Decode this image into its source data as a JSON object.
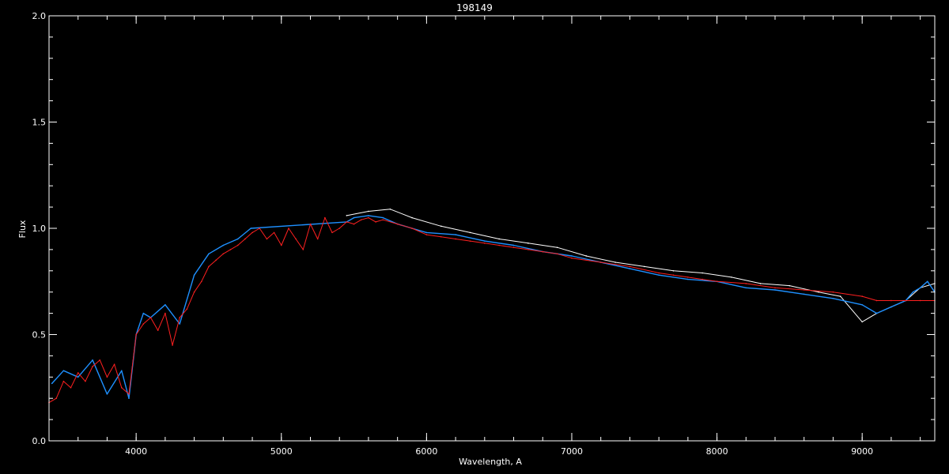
{
  "chart_data": {
    "type": "line",
    "title": "198149",
    "xlabel": "Wavelength, A",
    "ylabel": "Flux",
    "xlim": [
      3400,
      9500
    ],
    "ylim": [
      0.0,
      2.0
    ],
    "x_ticks": [
      {
        "value": 4000,
        "label": "4000"
      },
      {
        "value": 5000,
        "label": "5000"
      },
      {
        "value": 6000,
        "label": "6000"
      },
      {
        "value": 7000,
        "label": "7000"
      },
      {
        "value": 8000,
        "label": "8000"
      },
      {
        "value": 9000,
        "label": "9000"
      }
    ],
    "y_ticks": [
      {
        "value": 0.0,
        "label": "0.0"
      },
      {
        "value": 0.5,
        "label": "0.5"
      },
      {
        "value": 1.0,
        "label": "1.0"
      },
      {
        "value": 1.5,
        "label": "1.5"
      },
      {
        "value": 2.0,
        "label": "2.0"
      }
    ],
    "background": "#000000",
    "axis_color": "#ffffff",
    "series": [
      {
        "color": "#ffffff",
        "x": [
          5450,
          5600,
          5750,
          5900,
          6100,
          6300,
          6500,
          6700,
          6900,
          7100,
          7300,
          7500,
          7700,
          7900,
          8100,
          8300,
          8500,
          8700,
          8850,
          9000,
          9100,
          9200,
          9300,
          9400,
          9500
        ],
        "y": [
          1.06,
          1.08,
          1.09,
          1.05,
          1.01,
          0.98,
          0.95,
          0.93,
          0.91,
          0.87,
          0.84,
          0.82,
          0.8,
          0.79,
          0.77,
          0.74,
          0.73,
          0.7,
          0.68,
          0.56,
          0.6,
          0.63,
          0.66,
          0.72,
          0.74
        ]
      },
      {
        "color": "#1e90ff",
        "x": [
          3420,
          3500,
          3600,
          3700,
          3800,
          3900,
          3950,
          4000,
          4050,
          4100,
          4200,
          4300,
          4400,
          4500,
          4600,
          4700,
          4790,
          5450,
          5500,
          5600,
          5700,
          5800,
          5900,
          6000,
          6200,
          6400,
          6600,
          6800,
          7000,
          7200,
          7400,
          7600,
          7800,
          8000,
          8200,
          8400,
          8600,
          8800,
          9000,
          9100,
          9200,
          9300,
          9350,
          9400,
          9450,
          9500
        ],
        "y": [
          0.27,
          0.33,
          0.3,
          0.38,
          0.22,
          0.33,
          0.2,
          0.5,
          0.6,
          0.58,
          0.64,
          0.55,
          0.78,
          0.88,
          0.92,
          0.95,
          1.0,
          1.03,
          1.05,
          1.06,
          1.05,
          1.02,
          1.0,
          0.98,
          0.97,
          0.94,
          0.92,
          0.89,
          0.87,
          0.84,
          0.81,
          0.78,
          0.76,
          0.75,
          0.72,
          0.71,
          0.69,
          0.67,
          0.64,
          0.6,
          0.63,
          0.66,
          0.7,
          0.72,
          0.75,
          0.7
        ]
      },
      {
        "color": "#ff2020",
        "x": [
          3400,
          3450,
          3500,
          3550,
          3600,
          3650,
          3700,
          3750,
          3800,
          3850,
          3900,
          3950,
          4000,
          4050,
          4100,
          4150,
          4200,
          4250,
          4300,
          4350,
          4400,
          4450,
          4500,
          4550,
          4600,
          4650,
          4700,
          4750,
          4800,
          4850,
          4900,
          4950,
          5000,
          5050,
          5100,
          5150,
          5200,
          5250,
          5300,
          5350,
          5400,
          5450,
          5500,
          5550,
          5600,
          5650,
          5700,
          5800,
          5900,
          6000,
          6100,
          6200,
          6300,
          6400,
          6500,
          6600,
          6700,
          6800,
          6900,
          7000,
          7200,
          7400,
          7600,
          7700,
          7800,
          7900,
          8000,
          8200,
          8400,
          8600,
          8800,
          9000,
          9100,
          9200,
          9300,
          9400,
          9500
        ],
        "y": [
          0.18,
          0.2,
          0.28,
          0.25,
          0.32,
          0.28,
          0.35,
          0.38,
          0.3,
          0.36,
          0.25,
          0.22,
          0.5,
          0.55,
          0.58,
          0.52,
          0.6,
          0.45,
          0.58,
          0.62,
          0.7,
          0.75,
          0.82,
          0.85,
          0.88,
          0.9,
          0.92,
          0.95,
          0.98,
          1.0,
          0.95,
          0.98,
          0.92,
          1.0,
          0.95,
          0.9,
          1.02,
          0.95,
          1.05,
          0.98,
          1.0,
          1.03,
          1.02,
          1.04,
          1.05,
          1.03,
          1.04,
          1.02,
          1.0,
          0.97,
          0.96,
          0.95,
          0.94,
          0.93,
          0.92,
          0.91,
          0.9,
          0.89,
          0.88,
          0.86,
          0.84,
          0.82,
          0.79,
          0.78,
          0.77,
          0.76,
          0.75,
          0.74,
          0.72,
          0.71,
          0.7,
          0.68,
          0.66,
          0.66,
          0.66,
          0.66,
          0.66
        ]
      }
    ]
  }
}
